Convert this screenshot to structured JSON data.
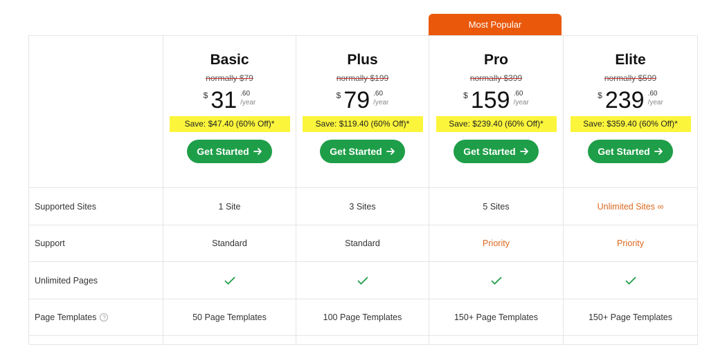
{
  "badge": "Most Popular",
  "plans": [
    {
      "name": "Basic",
      "normally": "normally $79",
      "currency": "$",
      "amount": "31",
      "cents": ".60",
      "period": "/year",
      "save": "Save: $47.40 (60% Off)*",
      "cta": "Get Started"
    },
    {
      "name": "Plus",
      "normally": "normally $199",
      "currency": "$",
      "amount": "79",
      "cents": ".60",
      "period": "/year",
      "save": "Save: $119.40 (60% Off)*",
      "cta": "Get Started"
    },
    {
      "name": "Pro",
      "normally": "normally $399",
      "currency": "$",
      "amount": "159",
      "cents": ".60",
      "period": "/year",
      "save": "Save: $239.40 (60% Off)*",
      "cta": "Get Started"
    },
    {
      "name": "Elite",
      "normally": "normally $599",
      "currency": "$",
      "amount": "239",
      "cents": ".60",
      "period": "/year",
      "save": "Save: $359.40 (60% Off)*",
      "cta": "Get Started"
    }
  ],
  "rows": [
    {
      "label": "Supported Sites",
      "values": [
        "1 Site",
        "3 Sites",
        "5 Sites",
        "Unlimited Sites ∞"
      ]
    },
    {
      "label": "Support",
      "values": [
        "Standard",
        "Standard",
        "Priority",
        "Priority"
      ]
    },
    {
      "label": "Unlimited Pages",
      "values": [
        "check",
        "check",
        "check",
        "check"
      ]
    },
    {
      "label": "Page Templates",
      "values": [
        "50 Page Templates",
        "100 Page Templates",
        "150+ Page Templates",
        "150+ Page Templates"
      ]
    }
  ],
  "colors": {
    "accent_orange": "#ea580c",
    "button_green": "#1e9e48",
    "highlight_yellow": "#fbf53c",
    "check_green": "#1e9e48"
  },
  "icons": {
    "arrow": "arrow-right-icon",
    "check": "check-icon",
    "help": "help-circle-icon"
  }
}
